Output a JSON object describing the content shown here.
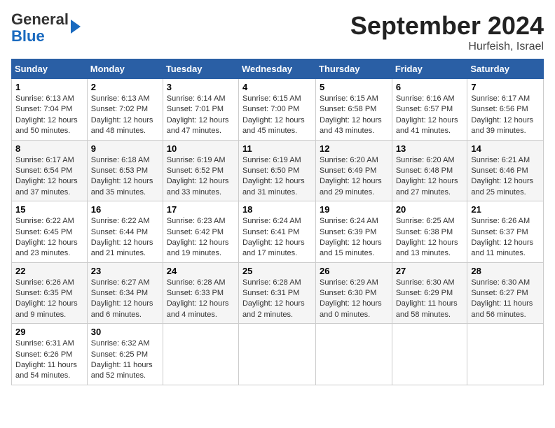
{
  "logo": {
    "line1": "General",
    "line2": "Blue"
  },
  "title": "September 2024",
  "subtitle": "Hurfeish, Israel",
  "days_of_week": [
    "Sunday",
    "Monday",
    "Tuesday",
    "Wednesday",
    "Thursday",
    "Friday",
    "Saturday"
  ],
  "weeks": [
    [
      {
        "day": "1",
        "info": "Sunrise: 6:13 AM\nSunset: 7:04 PM\nDaylight: 12 hours and 50 minutes."
      },
      {
        "day": "2",
        "info": "Sunrise: 6:13 AM\nSunset: 7:02 PM\nDaylight: 12 hours and 48 minutes."
      },
      {
        "day": "3",
        "info": "Sunrise: 6:14 AM\nSunset: 7:01 PM\nDaylight: 12 hours and 47 minutes."
      },
      {
        "day": "4",
        "info": "Sunrise: 6:15 AM\nSunset: 7:00 PM\nDaylight: 12 hours and 45 minutes."
      },
      {
        "day": "5",
        "info": "Sunrise: 6:15 AM\nSunset: 6:58 PM\nDaylight: 12 hours and 43 minutes."
      },
      {
        "day": "6",
        "info": "Sunrise: 6:16 AM\nSunset: 6:57 PM\nDaylight: 12 hours and 41 minutes."
      },
      {
        "day": "7",
        "info": "Sunrise: 6:17 AM\nSunset: 6:56 PM\nDaylight: 12 hours and 39 minutes."
      }
    ],
    [
      {
        "day": "8",
        "info": "Sunrise: 6:17 AM\nSunset: 6:54 PM\nDaylight: 12 hours and 37 minutes."
      },
      {
        "day": "9",
        "info": "Sunrise: 6:18 AM\nSunset: 6:53 PM\nDaylight: 12 hours and 35 minutes."
      },
      {
        "day": "10",
        "info": "Sunrise: 6:19 AM\nSunset: 6:52 PM\nDaylight: 12 hours and 33 minutes."
      },
      {
        "day": "11",
        "info": "Sunrise: 6:19 AM\nSunset: 6:50 PM\nDaylight: 12 hours and 31 minutes."
      },
      {
        "day": "12",
        "info": "Sunrise: 6:20 AM\nSunset: 6:49 PM\nDaylight: 12 hours and 29 minutes."
      },
      {
        "day": "13",
        "info": "Sunrise: 6:20 AM\nSunset: 6:48 PM\nDaylight: 12 hours and 27 minutes."
      },
      {
        "day": "14",
        "info": "Sunrise: 6:21 AM\nSunset: 6:46 PM\nDaylight: 12 hours and 25 minutes."
      }
    ],
    [
      {
        "day": "15",
        "info": "Sunrise: 6:22 AM\nSunset: 6:45 PM\nDaylight: 12 hours and 23 minutes."
      },
      {
        "day": "16",
        "info": "Sunrise: 6:22 AM\nSunset: 6:44 PM\nDaylight: 12 hours and 21 minutes."
      },
      {
        "day": "17",
        "info": "Sunrise: 6:23 AM\nSunset: 6:42 PM\nDaylight: 12 hours and 19 minutes."
      },
      {
        "day": "18",
        "info": "Sunrise: 6:24 AM\nSunset: 6:41 PM\nDaylight: 12 hours and 17 minutes."
      },
      {
        "day": "19",
        "info": "Sunrise: 6:24 AM\nSunset: 6:39 PM\nDaylight: 12 hours and 15 minutes."
      },
      {
        "day": "20",
        "info": "Sunrise: 6:25 AM\nSunset: 6:38 PM\nDaylight: 12 hours and 13 minutes."
      },
      {
        "day": "21",
        "info": "Sunrise: 6:26 AM\nSunset: 6:37 PM\nDaylight: 12 hours and 11 minutes."
      }
    ],
    [
      {
        "day": "22",
        "info": "Sunrise: 6:26 AM\nSunset: 6:35 PM\nDaylight: 12 hours and 9 minutes."
      },
      {
        "day": "23",
        "info": "Sunrise: 6:27 AM\nSunset: 6:34 PM\nDaylight: 12 hours and 6 minutes."
      },
      {
        "day": "24",
        "info": "Sunrise: 6:28 AM\nSunset: 6:33 PM\nDaylight: 12 hours and 4 minutes."
      },
      {
        "day": "25",
        "info": "Sunrise: 6:28 AM\nSunset: 6:31 PM\nDaylight: 12 hours and 2 minutes."
      },
      {
        "day": "26",
        "info": "Sunrise: 6:29 AM\nSunset: 6:30 PM\nDaylight: 12 hours and 0 minutes."
      },
      {
        "day": "27",
        "info": "Sunrise: 6:30 AM\nSunset: 6:29 PM\nDaylight: 11 hours and 58 minutes."
      },
      {
        "day": "28",
        "info": "Sunrise: 6:30 AM\nSunset: 6:27 PM\nDaylight: 11 hours and 56 minutes."
      }
    ],
    [
      {
        "day": "29",
        "info": "Sunrise: 6:31 AM\nSunset: 6:26 PM\nDaylight: 11 hours and 54 minutes."
      },
      {
        "day": "30",
        "info": "Sunrise: 6:32 AM\nSunset: 6:25 PM\nDaylight: 11 hours and 52 minutes."
      },
      {
        "day": "",
        "info": ""
      },
      {
        "day": "",
        "info": ""
      },
      {
        "day": "",
        "info": ""
      },
      {
        "day": "",
        "info": ""
      },
      {
        "day": "",
        "info": ""
      }
    ]
  ]
}
